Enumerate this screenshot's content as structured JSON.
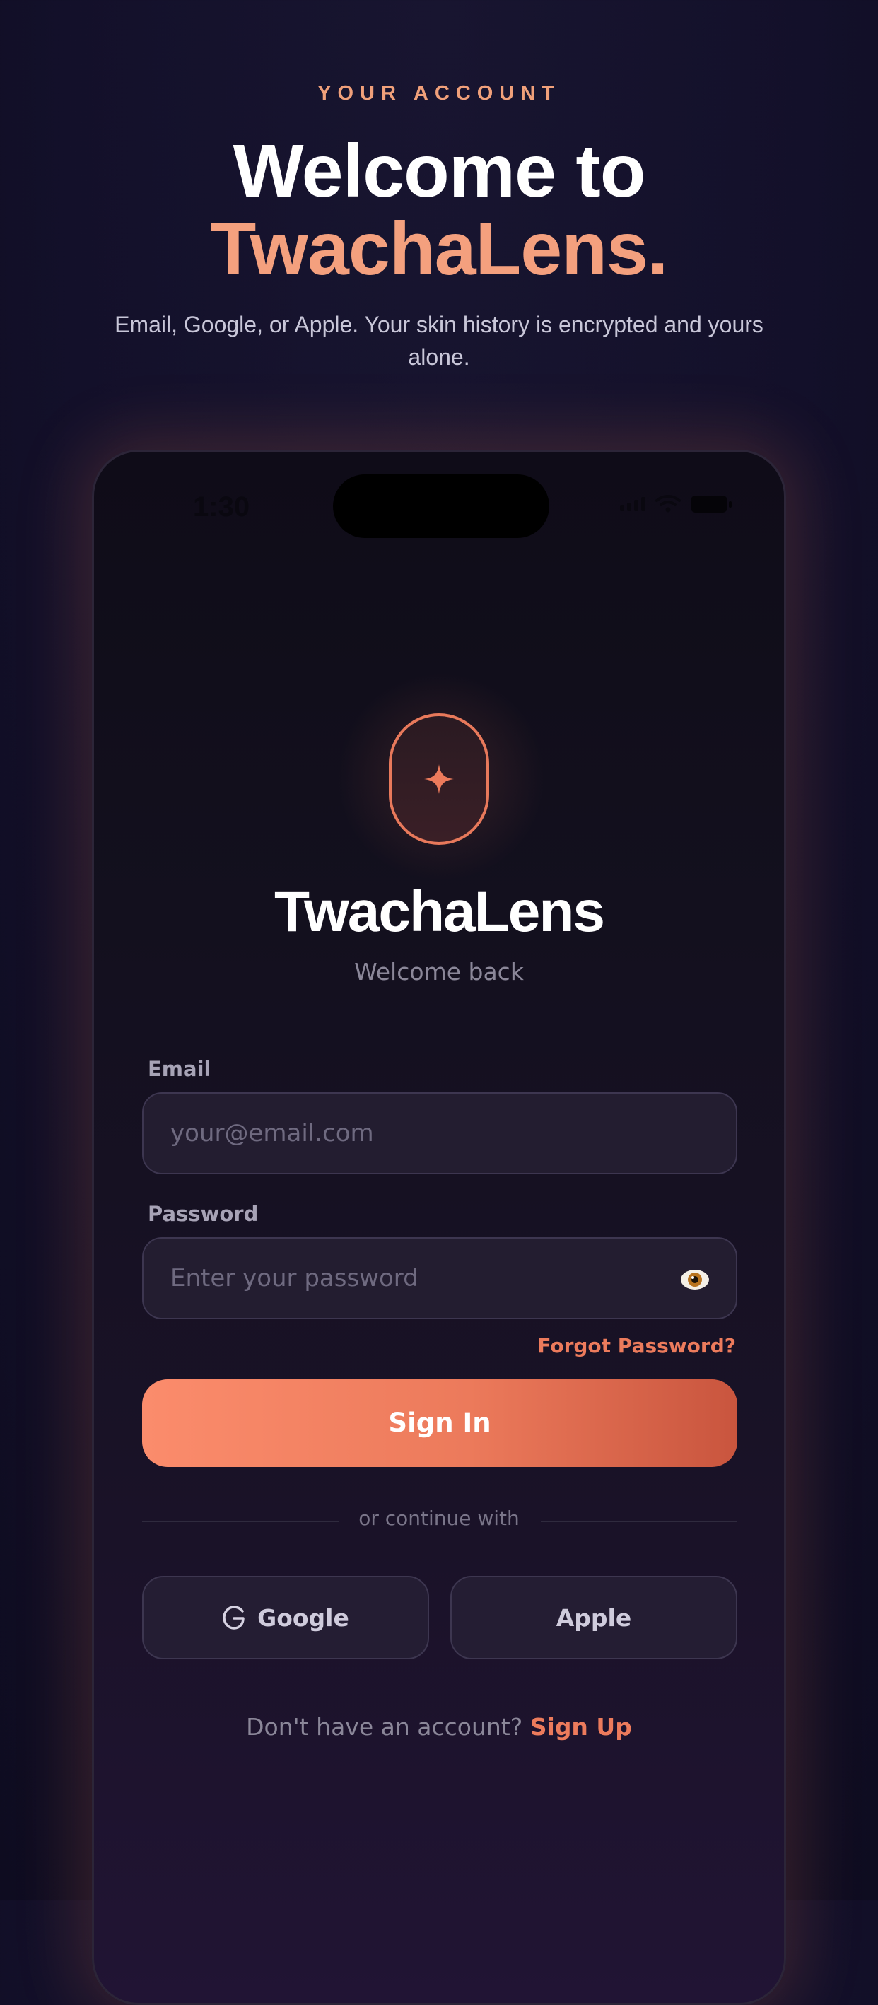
{
  "header": {
    "eyebrow": "YOUR ACCOUNT",
    "headline_line1": "Welcome to",
    "headline_line2": "TwachaLens.",
    "subtitle": "Email, Google, or Apple. Your skin history is encrypted and yours alone."
  },
  "device": {
    "status_time": "1:30"
  },
  "login": {
    "brand_name": "TwachaLens",
    "welcome_text": "Welcome back",
    "email_label": "Email",
    "email_placeholder": "your@email.com",
    "password_label": "Password",
    "password_placeholder": "Enter your password",
    "password_toggle_icon": "eye-icon",
    "forgot_password": "Forgot Password?",
    "sign_in_label": "Sign In",
    "divider_text": "or continue with",
    "google_label": "Google",
    "google_icon": "google-g-icon",
    "apple_label": "Apple",
    "signup_prompt": "Don't have an account?",
    "signup_link": "Sign Up"
  },
  "colors": {
    "accent": "#EC7B5C",
    "accent_light": "#F4A07E",
    "background": "#14112A"
  }
}
